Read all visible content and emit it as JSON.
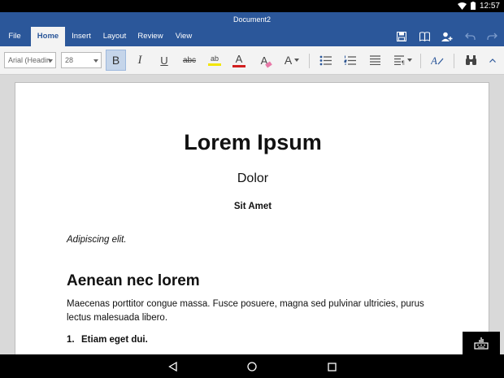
{
  "status": {
    "time": "12:57"
  },
  "window": {
    "title": "Document2"
  },
  "ribbon": {
    "tabs": [
      {
        "label": "File"
      },
      {
        "label": "Home"
      },
      {
        "label": "Insert"
      },
      {
        "label": "Layout"
      },
      {
        "label": "Review"
      },
      {
        "label": "View"
      }
    ],
    "active_tab": "Home"
  },
  "toolbar": {
    "font_name": "Arial (Headin",
    "font_size": "28",
    "bold_glyph": "B",
    "italic_glyph": "I",
    "underline_glyph": "U",
    "strike_glyph": "abc",
    "highlight_glyph": "ab",
    "font_color_glyph": "A",
    "clear_format_glyph": "A",
    "styles_glyph": "A",
    "accent_highlight": "#f2e600",
    "accent_font_color": "#d11f1f"
  },
  "document": {
    "title": "Lorem Ipsum",
    "subtitle": "Dolor",
    "small_heading": "Sit Amet",
    "italic_line": "Adipiscing elit.",
    "heading1": "Aenean nec lorem",
    "body": "Maecenas porttitor congue massa. Fusce posuere, magna sed pulvinar ultricies, purus lectus malesuada libero.",
    "list_items": [
      {
        "num": "1.",
        "text": "Etiam eget dui."
      }
    ]
  },
  "colors": {
    "ribbon": "#2b579a",
    "toolbar_bg": "#f3f3f3",
    "canvas": "#d9d9d9"
  }
}
